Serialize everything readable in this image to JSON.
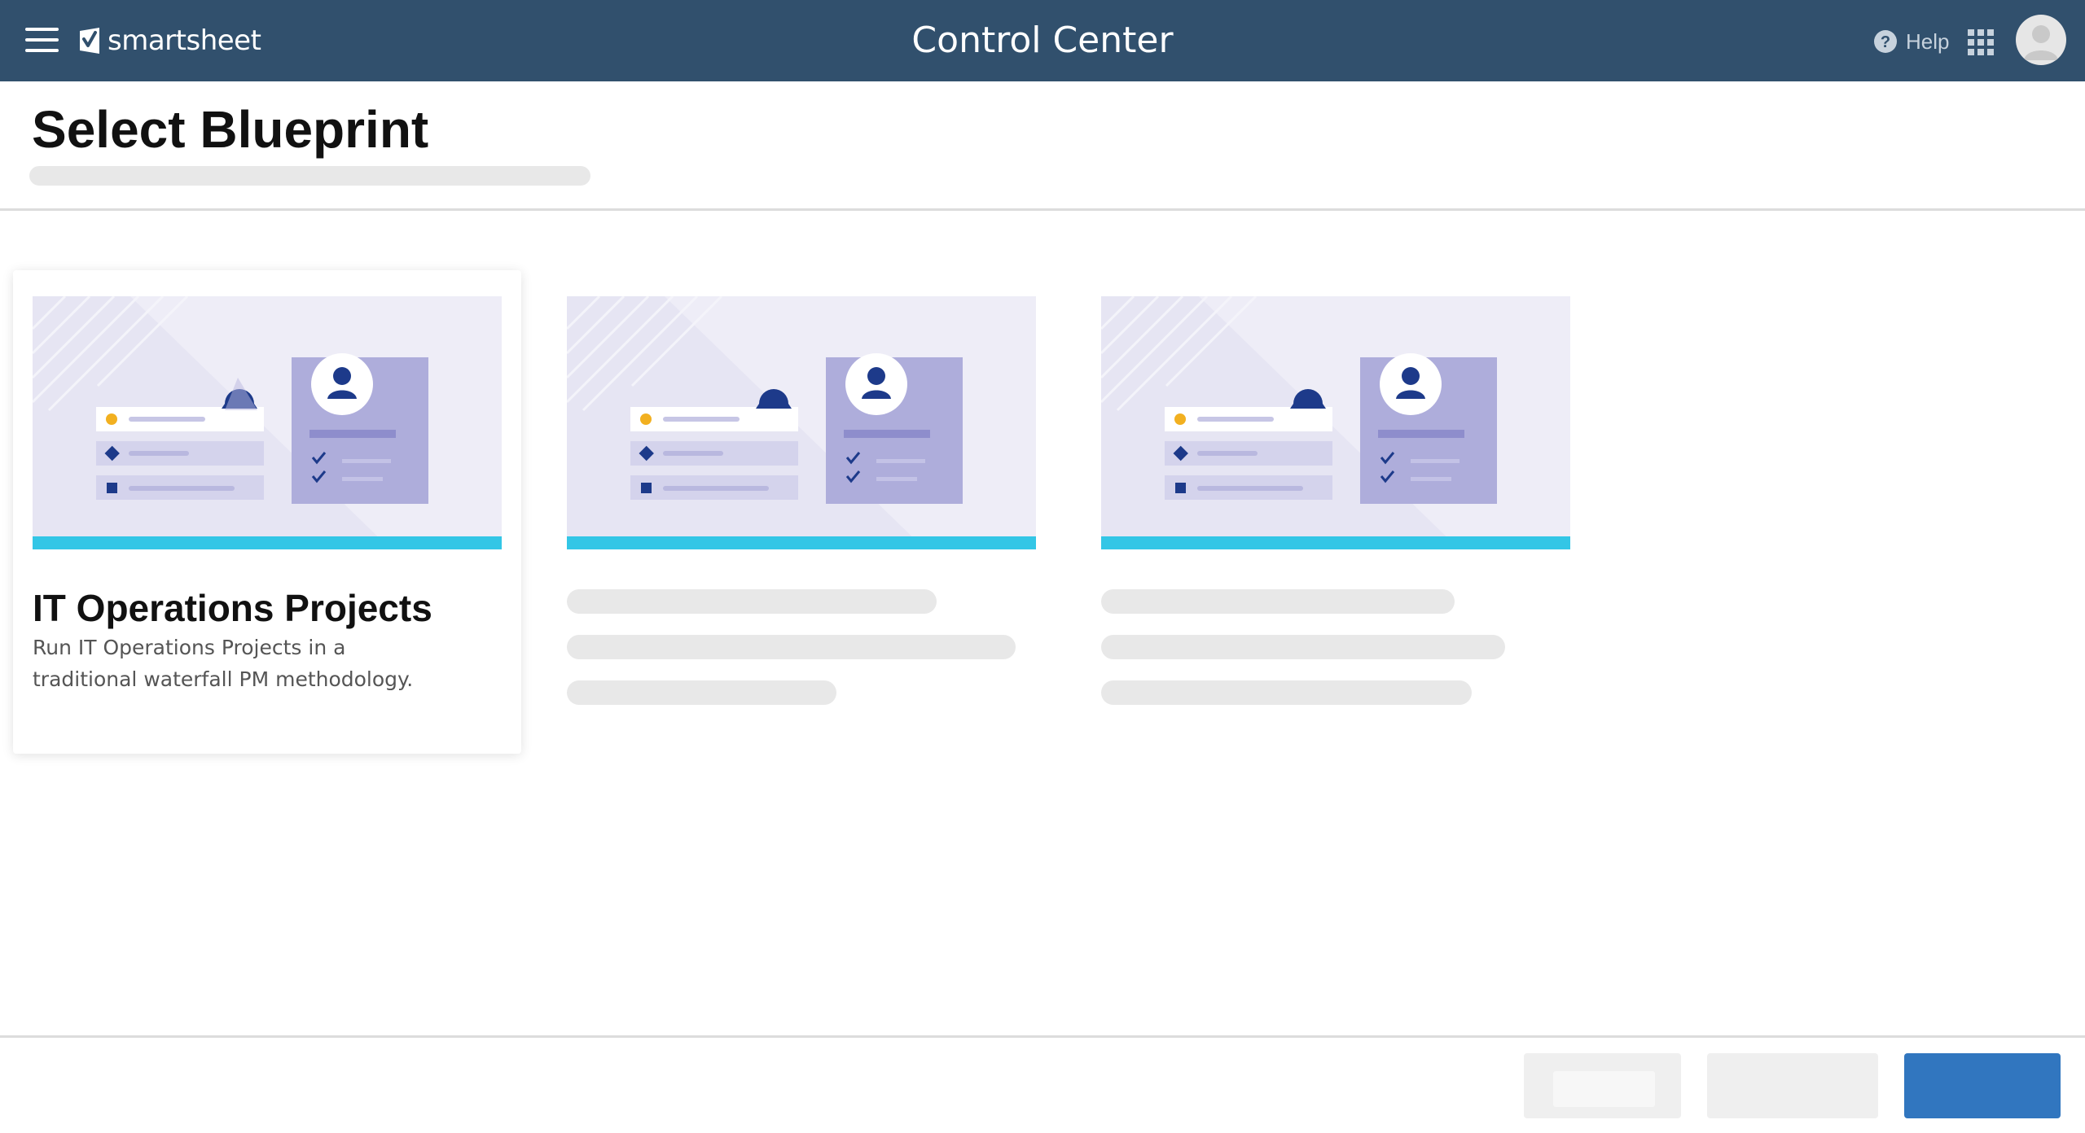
{
  "header": {
    "logo_text": "smartsheet",
    "app_title": "Control Center",
    "help_label": "Help",
    "icons": [
      "menu-icon",
      "smartsheet-logo-icon",
      "help-icon",
      "app-launcher-icon",
      "user-avatar-icon"
    ],
    "colors": {
      "bar": "#31506d",
      "text": "#ffffff"
    }
  },
  "page": {
    "title": "Select Blueprint"
  },
  "blueprints": [
    {
      "title": "IT Operations Projects",
      "description": "Run IT Operations Projects in a traditional waterfall PM methodology.",
      "selected": true
    },
    {
      "title": "",
      "description": "",
      "loading": true
    },
    {
      "title": "",
      "description": "",
      "loading": true
    }
  ],
  "colors": {
    "accent_bar": "#33c6e6",
    "thumbnail_bg": "#eeedf7",
    "primary_button": "#3176bf",
    "skeleton": "#e8e8e8"
  }
}
